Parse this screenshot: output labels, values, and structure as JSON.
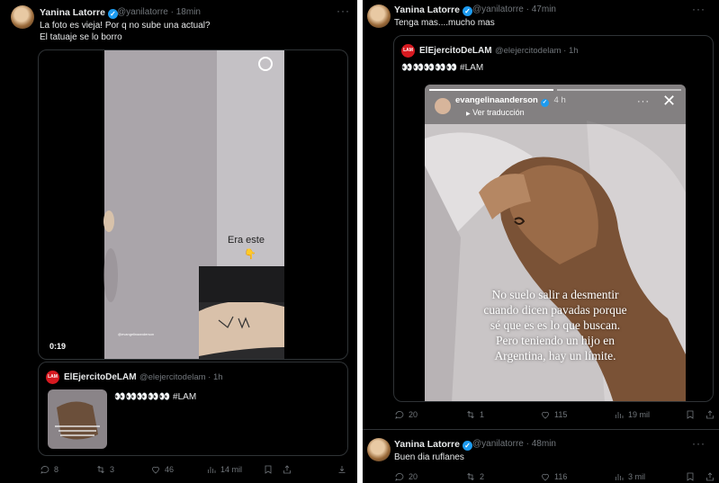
{
  "left": {
    "tweet": {
      "author_name": "Yanina Latorre",
      "handle": "@yanilatorre",
      "time": "18min",
      "text_line1": "La foto es vieja! Por q no sube una actual?",
      "text_line2": "El tatuaje se lo borro",
      "video": {
        "duration": "0:19",
        "overlay_text": "Era este",
        "watermark": "@evangelinaanderson"
      },
      "quoted": {
        "author_name": "ElEjercitoDeLAM",
        "handle": "@elejercitodelam",
        "time": "1h",
        "text": "👀👀👀👀👀 #LAM",
        "logo_text": "LAM"
      },
      "actions": {
        "replies": "8",
        "retweets": "3",
        "likes": "46",
        "views": "14 mil"
      }
    }
  },
  "right": {
    "tweet1": {
      "author_name": "Yanina Latorre",
      "handle": "@yanilatorre",
      "time": "47min",
      "text": "Tenga mas....mucho mas",
      "quoted": {
        "author_name": "ElEjercitoDeLAM",
        "handle": "@elejercitodelam",
        "time": "1h",
        "text": "👀👀👀👀👀 #LAM",
        "logo_text": "LAM",
        "story": {
          "user": "evangelinaanderson",
          "time": "4 h",
          "translate": "Ver traducción",
          "caption": [
            "No suelo salir a desmentir",
            "cuando dicen pavadas porque",
            "sé que es es lo que buscan.",
            "Pero teniendo un hijo en",
            "Argentina, hay un límite."
          ]
        }
      },
      "actions": {
        "replies": "20",
        "retweets": "1",
        "likes": "115",
        "views": "19 mil"
      }
    },
    "tweet2": {
      "author_name": "Yanina Latorre",
      "handle": "@yanilatorre",
      "time": "48min",
      "text": "Buen dia ruflanes",
      "actions": {
        "replies": "20",
        "retweets": "2",
        "likes": "116",
        "views": "3 mil"
      }
    }
  },
  "colors": {
    "background": "#000000",
    "text": "#e7e9ea",
    "muted": "#71767b",
    "verified": "#1d9bf0",
    "lam_red": "#d71920"
  }
}
